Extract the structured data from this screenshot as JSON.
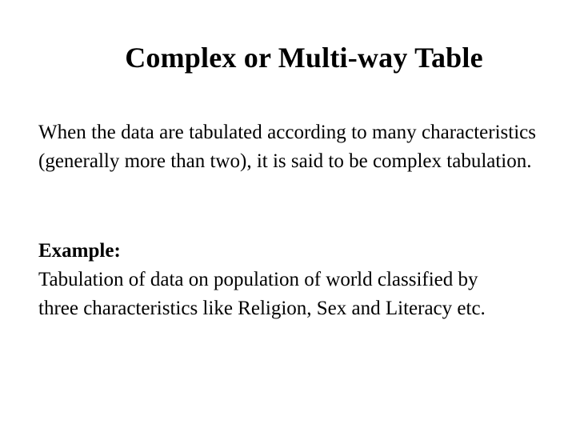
{
  "slide": {
    "title": "Complex or Multi-way Table",
    "definition": "When the data are tabulated according to many characteristics (generally more than two), it is said to be complex tabulation.",
    "example": {
      "label": "Example:",
      "line1": "Tabulation of data on population of world classified by",
      "line2": "three characteristics like Religion, Sex and Literacy etc."
    }
  }
}
